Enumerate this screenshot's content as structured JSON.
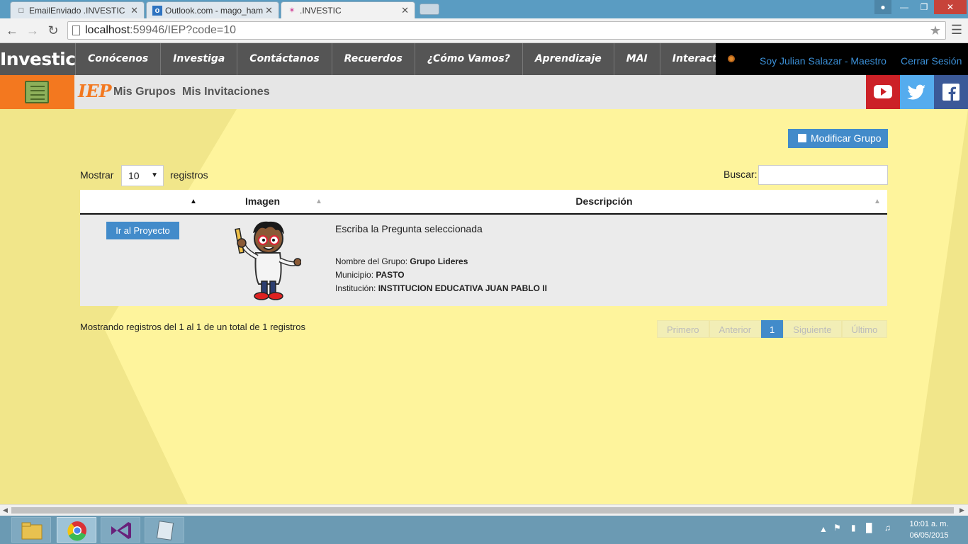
{
  "browser": {
    "tabs": [
      {
        "title": "EmailEnviado .INVESTIC",
        "icon": "page-icon"
      },
      {
        "title": "Outlook.com - mago_ham",
        "icon": "outlook-icon"
      },
      {
        "title": ".INVESTIC",
        "icon": "investic-icon",
        "active": true
      }
    ],
    "url_host": "localhost",
    "url_rest": ":59946/IEP?code=10"
  },
  "nav": {
    "brand": "Investic",
    "items": [
      "Conócenos",
      "Investiga",
      "Contáctanos",
      "Recuerdos",
      "¿Cómo Vamos?",
      "Aprendizaje",
      "MAI",
      "Interactua"
    ],
    "user": "Soy Julian Salazar - Maestro",
    "logout": "Cerrar Sesión"
  },
  "subheader": {
    "logo_text": "IEP",
    "links": [
      "Mis Grupos",
      "Mis Invitaciones"
    ],
    "social": [
      "youtube-icon",
      "twitter-icon",
      "facebook-icon"
    ]
  },
  "content": {
    "modify_button": "Modificar Grupo",
    "show_label": "Mostrar",
    "show_value": "10",
    "records_label": "registros",
    "search_label": "Buscar:",
    "search_value": "",
    "columns": [
      "",
      "Imagen",
      "Descripción"
    ],
    "row": {
      "button": "Ir al Proyecto",
      "title": "Escriba la Pregunta seleccionada",
      "group_label": "Nombre del Grupo:",
      "group_value": "Grupo Lideres",
      "municipio_label": "Municipio:",
      "municipio_value": "PASTO",
      "institucion_label": "Institución:",
      "institucion_value": "INSTITUCION EDUCATIVA JUAN PABLO II"
    },
    "info": "Mostrando registros del 1 al 1 de un total de 1 registros",
    "pager": [
      "Primero",
      "Anterior",
      "1",
      "Siguiente",
      "Último"
    ]
  },
  "taskbar": {
    "time": "10:01 a. m.",
    "date": "06/05/2015"
  },
  "colors": {
    "nav_bg": "#555555",
    "accent_blue": "#428bca",
    "content_bg": "#fef49c",
    "iep_orange": "#f3781f"
  }
}
